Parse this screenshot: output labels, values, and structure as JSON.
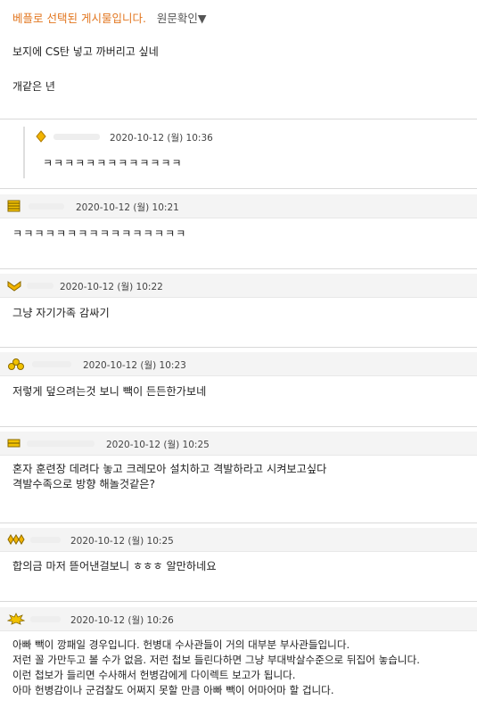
{
  "post": {
    "best_notice": "베플로 선택된 게시물입니다.",
    "original_link": "원문확인▼",
    "lines": [
      "보지에 CS탄 넣고 까버리고 싶네",
      "개같은 년"
    ]
  },
  "reply": {
    "date": "2020-10-12 (월) 10:36",
    "icon": "diamond-level-icon",
    "text": "ㅋㅋㅋㅋㅋㅋㅋㅋㅋㅋㅋㅋㅋ"
  },
  "comments": [
    {
      "date": "2020-10-12 (월) 10:21",
      "icon": "stacked-bars-level-icon",
      "lines": [
        "ㅋㅋㅋㅋㅋㅋㅋㅋㅋㅋㅋㅋㅋㅋㅋㅋ"
      ]
    },
    {
      "date": "2020-10-12 (월) 10:22",
      "icon": "chevron-level-icon",
      "lines": [
        "그냥 자기가족 감싸기"
      ]
    },
    {
      "date": "2020-10-12 (월) 10:23",
      "icon": "gold-pile-level-icon",
      "lines": [
        "저렇게 덮으려는것 보니 빽이 든든한가보네"
      ]
    },
    {
      "date": "2020-10-12 (월) 10:25",
      "icon": "double-bar-level-icon",
      "lines": [
        "혼자 훈련장 데려다 놓고 크레모아 설치하고 격발하라고 시켜보고싶다",
        "격발수족으로 방향 해놀것같은?"
      ]
    },
    {
      "date": "2020-10-12 (월) 10:25",
      "icon": "triple-diamond-level-icon",
      "lines": [
        "합의금 마저 뜯어낸걸보니 ㅎㅎㅎ 알만하네요"
      ]
    },
    {
      "date": "2020-10-12 (월) 10:26",
      "icon": "sun-badge-level-icon",
      "lines": [
        "아빠 빽이 깡패일 경우입니다. 헌병대 수사관들이 거의 대부분 부사관들입니다.",
        "저런 꼴 가만두고 볼 수가 없음. 저런 첩보 들린다하면 그냥 부대박살수준으로 뒤집어 놓습니다.",
        "이런 첩보가 들리면 수사해서 헌병감에게 다이렉트 보고가 됩니다.",
        "아마 헌병감이나 군검찰도 어쩌지 못할 만큼 아빠 빽이 어마어마 할 겁니다."
      ]
    }
  ],
  "colors": {
    "accent": "#e2761f",
    "header_bg": "#f4f4f4",
    "icon_gold": "#e0a800"
  }
}
